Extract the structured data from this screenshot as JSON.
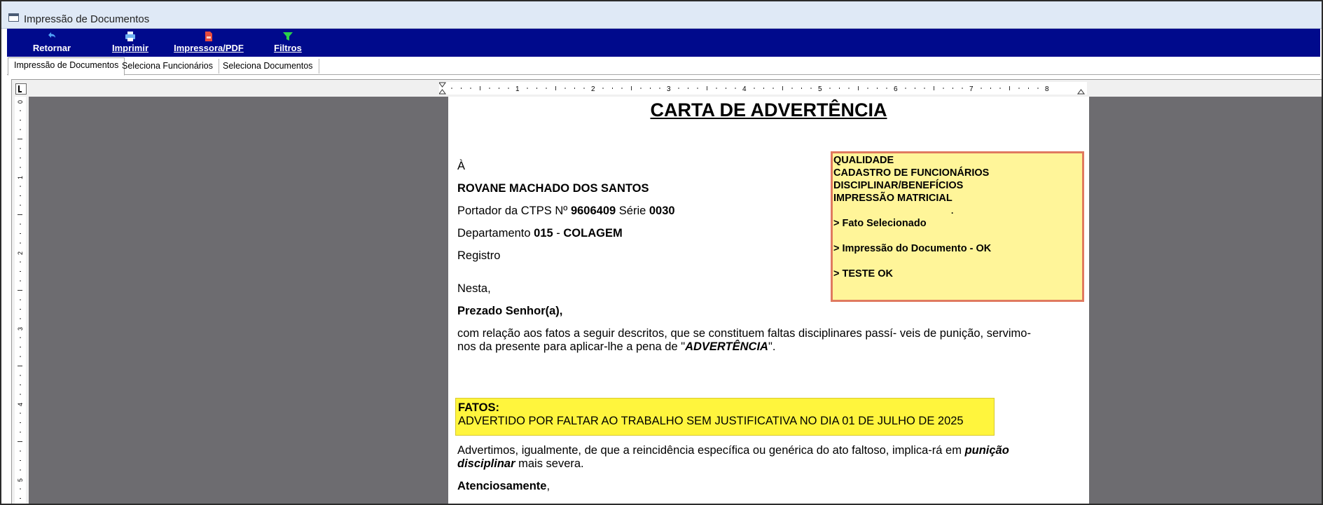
{
  "window": {
    "title": "Impressão de Documentos"
  },
  "toolbar": {
    "retornar": "Retornar",
    "imprimir": "Imprimir",
    "impressora_pdf": "Impressora/PDF",
    "filtros": "Filtros"
  },
  "tabs": [
    {
      "label": "Impressão de Documentos",
      "active": true
    },
    {
      "label": "Seleciona Funcionários",
      "active": false
    },
    {
      "label": "Seleciona Documentos",
      "active": false
    }
  ],
  "ruler": {
    "top_numbers": [
      "1",
      "2",
      "3",
      "4",
      "5",
      "6",
      "7",
      "8"
    ],
    "left_numbers": [
      "0",
      "1",
      "2",
      "3",
      "4",
      "5"
    ]
  },
  "document": {
    "title": "CARTA DE ADVERTÊNCIA",
    "to": "À",
    "name": "ROVANE MACHADO DOS SANTOS",
    "ctps_prefix": "Portador da CTPS Nº ",
    "ctps_number": "9606409",
    "serie_label": " Série ",
    "serie_number": "0030",
    "dept_prefix": "Departamento ",
    "dept_code": "015",
    "dept_sep": " - ",
    "dept_name": "COLAGEM",
    "registro": "Registro",
    "nesta": "Nesta,",
    "greeting": "Prezado Senhor(a),",
    "body_line1": "com relação aos fatos a seguir descritos, que se constituem faltas disciplinares passí- veis de punição, servimo-",
    "body_line2_a": "nos da presente para aplicar-lhe a pena de \"",
    "body_line2_b": "ADVERTÊNCIA",
    "body_line2_c": "\".",
    "fatos_label": "FATOS:",
    "fatos_text": "ADVERTIDO POR FALTAR AO TRABALHO SEM JUSTIFICATIVA NO DIA 01 DE JULHO DE 2025",
    "adv_line1_a": "Advertimos, igualmente, de que a reincidência específica ou genérica do ato  faltoso,  implica-rá em ",
    "adv_line1_b": "punição",
    "adv_line2_a": "disciplinar",
    "adv_line2_b": " mais severa.",
    "closing_a": "Atenciosamente",
    "closing_b": ","
  },
  "note": {
    "lines": [
      "QUALIDADE",
      "CADASTRO DE FUNCIONÁRIOS",
      "DISCIPLINAR/BENEFÍCIOS",
      "IMPRESSÃO MATRICIAL"
    ],
    "dot": ".",
    "items": [
      "> Fato Selecionado",
      "> Impressão do Documento - OK",
      "> TESTE OK"
    ]
  },
  "colors": {
    "toolbar": "#000a8c",
    "note_bg": "#fff599",
    "note_border": "#e07a5f",
    "fatos_bg": "#fff53d",
    "workspace": "#6d6c70"
  }
}
